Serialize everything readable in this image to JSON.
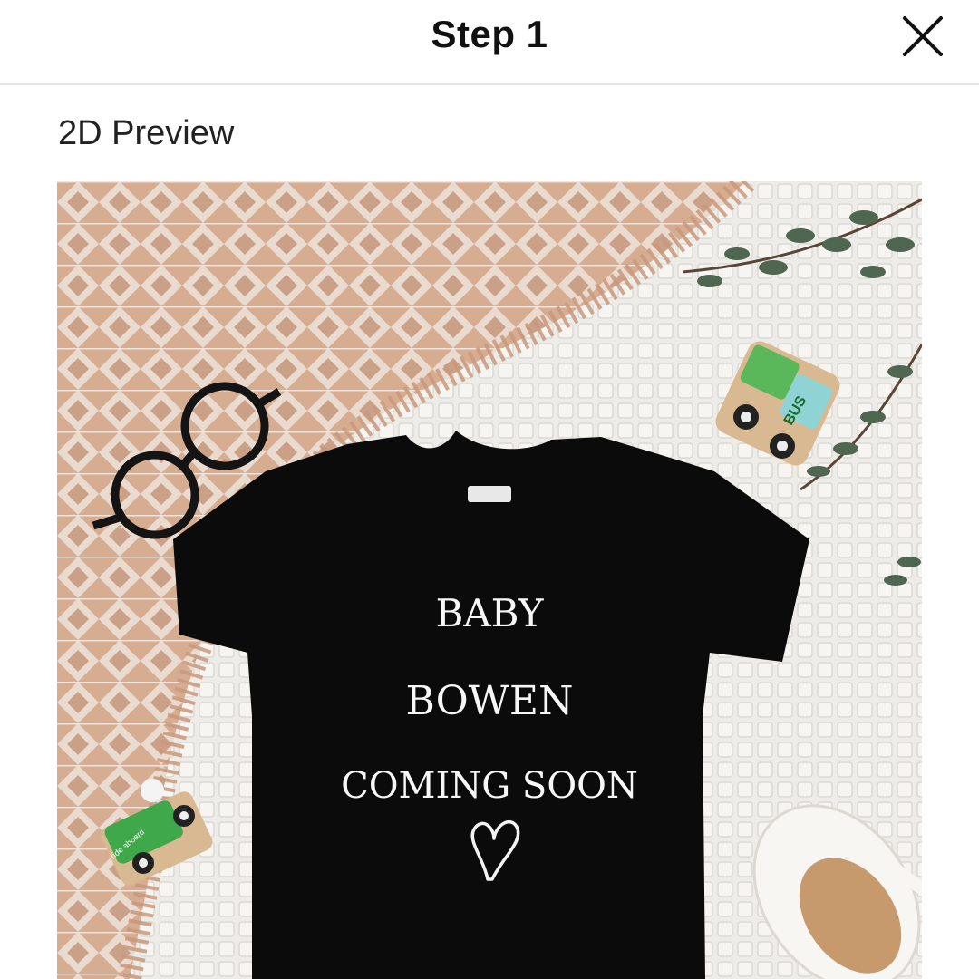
{
  "header": {
    "title": "Step 1",
    "close_icon": "close-icon"
  },
  "preview": {
    "label": "2D Preview",
    "garment_color": "#0b0b0b",
    "print_lines": [
      "BABY",
      "BOWEN",
      "COMING SOON"
    ],
    "print_symbol": "heart-icon",
    "props": {
      "bus_label": "BUS",
      "car_label": "ride aboard"
    }
  },
  "colors": {
    "blanket": "#d2a78d",
    "fabric": "#efeeeb",
    "foliage": "#556a52",
    "toy_green": "#4caf50",
    "toy_blue": "#7ecfd0"
  }
}
